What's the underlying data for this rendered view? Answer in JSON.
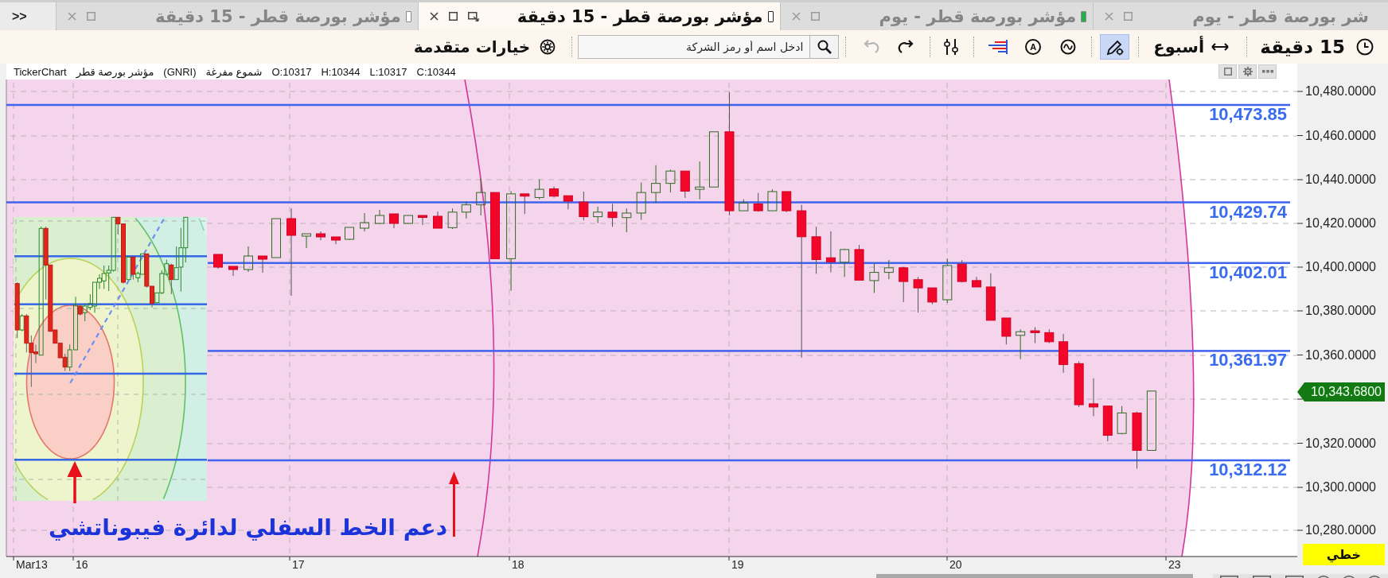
{
  "tabs": [
    {
      "title": "شر بورصة قطر - يوم",
      "selected": false
    },
    {
      "title": "مؤشر بورصة قطر - يوم",
      "selected": false,
      "color": "#22b14c"
    },
    {
      "title": "مؤشر بورصة قطر - 15 دقيقة",
      "selected": true,
      "color": "#ffffff"
    },
    {
      "title": "مؤشر بورصة قطر - 15 دقيقة",
      "selected": false,
      "color": "#ffffff"
    }
  ],
  "overflow_button": ">>",
  "toolbar": {
    "interval": "15 دقيقة",
    "period": "أسبوع",
    "draw_mode": {
      "on": true
    },
    "circled_letter": "A",
    "undo": {
      "disabled": false
    },
    "redo": {
      "disabled": true
    },
    "search": {
      "placeholder": "ادخل اسم أو رمز الشركة"
    },
    "advanced_options": "خيارات متقدمة"
  },
  "chart": {
    "info": {
      "source": "TickerChart",
      "instrument": "مؤشر بورصة قطر",
      "symbol": "(GNRI)",
      "style": "شموع مفرغة",
      "ohlc": [
        "C:10344",
        "L:10317",
        "H:10344",
        "O:10317"
      ]
    },
    "levels": [
      "10,473.85",
      "10,429.74",
      "10,402.01",
      "10,361.97",
      "10,312.12"
    ],
    "annotation": "دعم الخط السفلي لدائرة فيبوناتشي",
    "y_axis": [
      "10,480.0000",
      "10,460.0000",
      "10,440.0000",
      "10,420.0000",
      "10,400.0000",
      "10,380.0000",
      "10,360.0000",
      "10,320.0000",
      "10,300.0000",
      "10,280.0000"
    ],
    "x_axis": [
      "23",
      "20",
      "19",
      "18",
      "17",
      "16",
      "Mar13"
    ],
    "last_price": "10,343.6800",
    "chart_type": "خطي"
  }
}
